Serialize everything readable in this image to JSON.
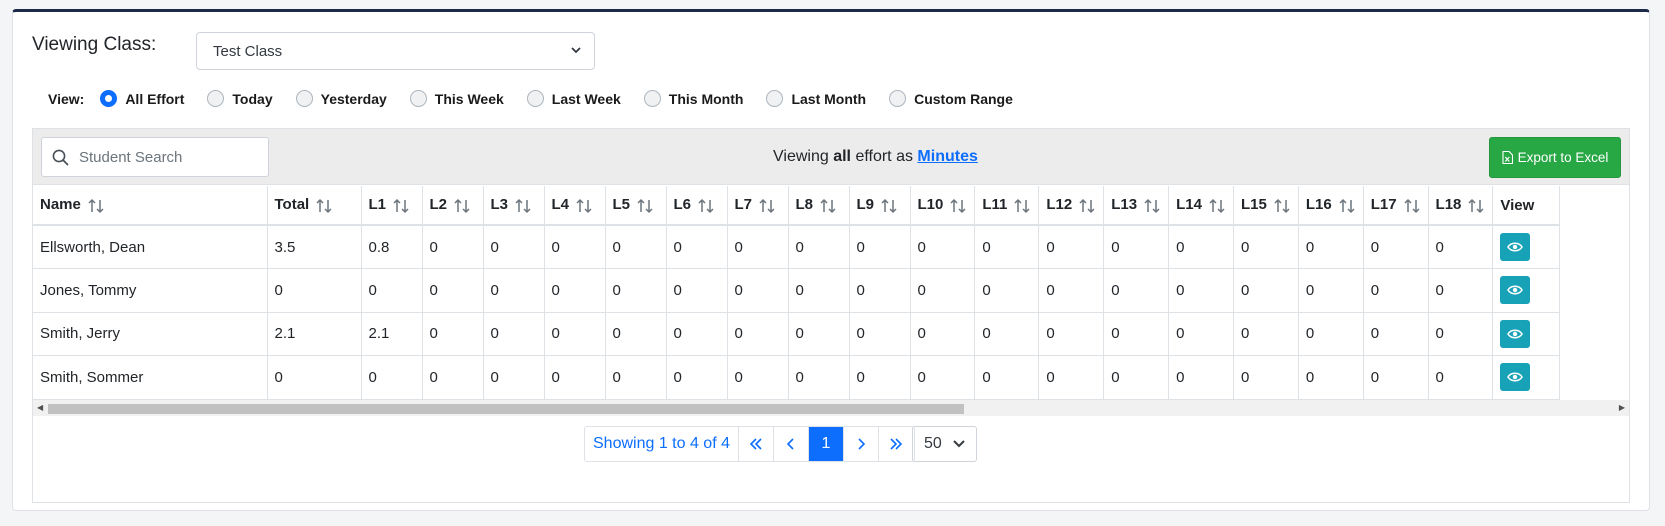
{
  "class_selector": {
    "label": "Viewing Class:",
    "value": "Test Class"
  },
  "view_filter": {
    "label": "View:",
    "options": [
      "All Effort",
      "Today",
      "Yesterday",
      "This Week",
      "Last Week",
      "This Month",
      "Last Month",
      "Custom Range"
    ],
    "selected": "All Effort"
  },
  "toolbar": {
    "search_placeholder": "Student Search",
    "viewing_prefix": "Viewing",
    "viewing_scope": "all",
    "viewing_middle": "effort as",
    "viewing_unit": "Minutes",
    "export_label": "Export to Excel"
  },
  "table": {
    "columns": [
      "Name",
      "Total",
      "L1",
      "L2",
      "L3",
      "L4",
      "L5",
      "L6",
      "L7",
      "L8",
      "L9",
      "L10",
      "L11",
      "L12",
      "L13",
      "L14",
      "L15",
      "L16",
      "L17",
      "L18",
      "View"
    ],
    "rows": [
      [
        "Ellsworth, Dean",
        "3.5",
        "0.8",
        "0",
        "0",
        "0",
        "0",
        "0",
        "0",
        "0",
        "0",
        "0",
        "0",
        "0",
        "0",
        "0",
        "0",
        "0",
        "0",
        "0"
      ],
      [
        "Jones, Tommy",
        "0",
        "0",
        "0",
        "0",
        "0",
        "0",
        "0",
        "0",
        "0",
        "0",
        "0",
        "0",
        "0",
        "0",
        "0",
        "0",
        "0",
        "0",
        "0"
      ],
      [
        "Smith, Jerry",
        "2.1",
        "2.1",
        "0",
        "0",
        "0",
        "0",
        "0",
        "0",
        "0",
        "0",
        "0",
        "0",
        "0",
        "0",
        "0",
        "0",
        "0",
        "0",
        "0"
      ],
      [
        "Smith, Sommer",
        "0",
        "0",
        "0",
        "0",
        "0",
        "0",
        "0",
        "0",
        "0",
        "0",
        "0",
        "0",
        "0",
        "0",
        "0",
        "0",
        "0",
        "0",
        "0"
      ]
    ]
  },
  "pagination": {
    "info": "Showing 1 to 4 of 4",
    "current_page": "1",
    "page_size": "50"
  },
  "colors": {
    "primary": "#0d6efd",
    "success": "#28a745",
    "info": "#17a2b8",
    "header_bar": "#1b2a48"
  }
}
